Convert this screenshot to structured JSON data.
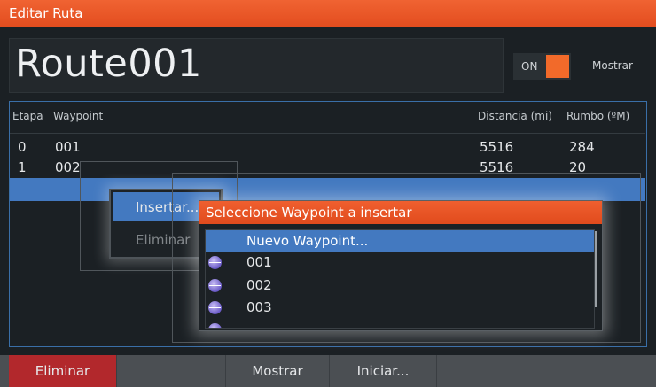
{
  "window": {
    "title": "Editar Ruta"
  },
  "route": {
    "name": "Route001",
    "toggle_state": "ON",
    "toggle_label": "Mostrar"
  },
  "table": {
    "headers": [
      "Etapa",
      "Waypoint",
      "Distancia (mi)",
      "Rumbo (ºM)"
    ],
    "rows": [
      {
        "etapa": "0",
        "waypoint": "001",
        "distancia": "5516",
        "rumbo": "284"
      },
      {
        "etapa": "1",
        "waypoint": "002",
        "distancia": "5516",
        "rumbo": "20"
      }
    ]
  },
  "context_menu": {
    "items": [
      "Insertar...",
      "Eliminar"
    ]
  },
  "waypoint_dialog": {
    "title": "Seleccione Waypoint a insertar",
    "new_item": "Nuevo Waypoint...",
    "waypoints": [
      "001",
      "002",
      "003"
    ]
  },
  "bottom_bar": {
    "delete": "Eliminar",
    "show": "Mostrar",
    "start": "Iniciar..."
  },
  "colors": {
    "accent_orange": "#f06332",
    "selection_blue": "#4379c0",
    "delete_red": "#b2282c"
  }
}
